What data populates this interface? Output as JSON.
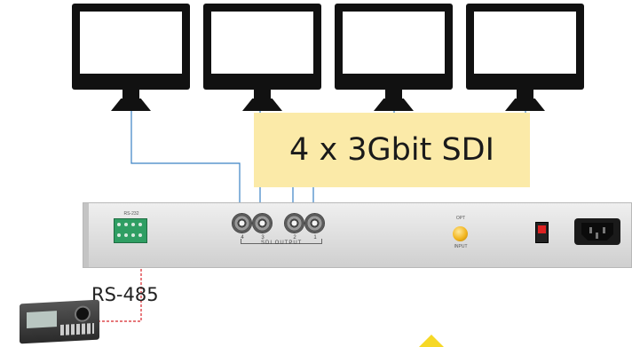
{
  "title_box": {
    "text": "4 x 3Gbit SDI"
  },
  "rs485": {
    "label": "RS-485"
  },
  "panel": {
    "sdi_output_label": "SDI OUTPUT",
    "bnc_numbers": [
      "4",
      "3",
      "2",
      "1"
    ],
    "led_top_label": "OPT",
    "led_bottom_label": "INPUT",
    "terminal_label": "RS-232"
  },
  "monitors": [
    "monitor-1",
    "monitor-2",
    "monitor-3",
    "monitor-4"
  ],
  "colors": {
    "sdi_wire": "#3b82c4",
    "rs485_wire": "#d8262b",
    "label_background": "#fbeaa8",
    "arrow": "#f6d826"
  }
}
